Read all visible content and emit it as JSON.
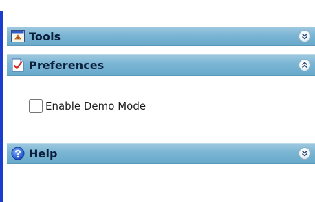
{
  "colors": {
    "rail": "#1a3ccf",
    "header_gradient_top": "#9dc8df",
    "header_gradient_bottom": "#69a9cb",
    "header_text": "#0b1f3b"
  },
  "panels": [
    {
      "title": "Tools",
      "icon": "tools-icon",
      "state": "collapsed",
      "toggle_icon": "chevron-down-double-icon"
    },
    {
      "title": "Preferences",
      "icon": "preferences-icon",
      "state": "expanded",
      "toggle_icon": "chevron-up-double-icon"
    },
    {
      "title": "Help",
      "icon": "help-icon",
      "state": "collapsed",
      "toggle_icon": "chevron-down-double-icon"
    }
  ],
  "preferences": {
    "enable_demo_mode": {
      "label": "Enable Demo Mode",
      "checked": false
    }
  }
}
